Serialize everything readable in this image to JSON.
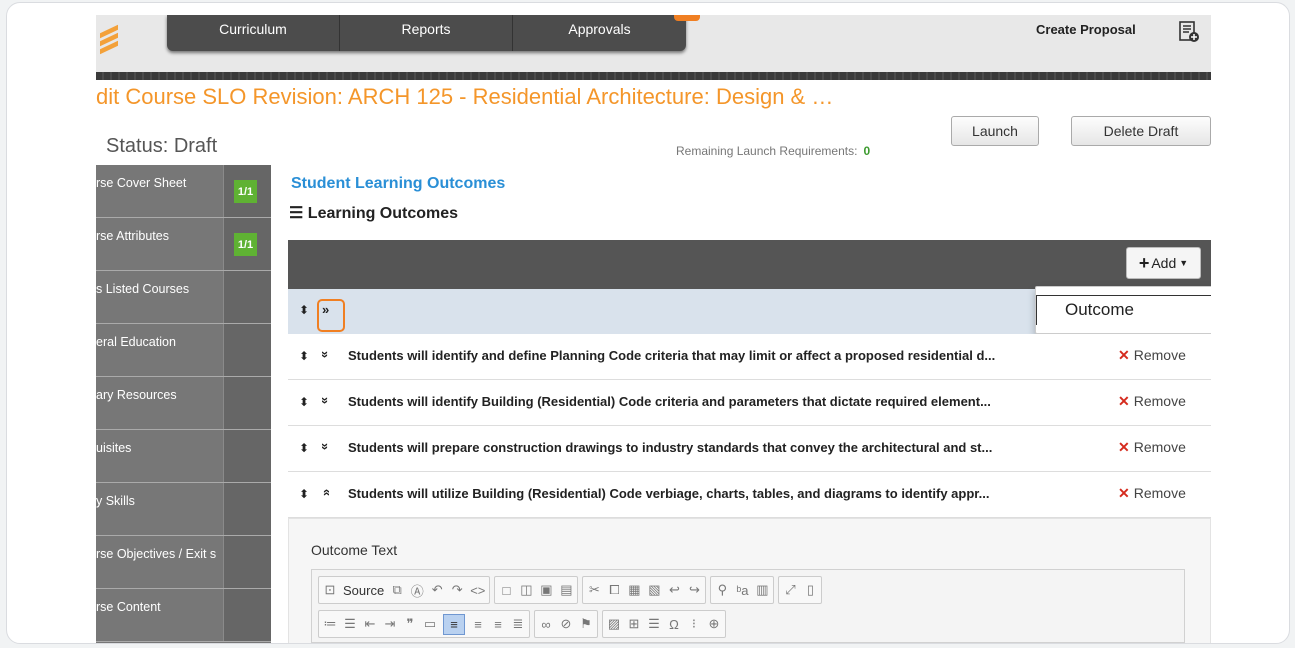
{
  "nav": {
    "items": [
      "Curriculum",
      "Reports",
      "Approvals"
    ],
    "create_label": "Create Proposal"
  },
  "header": {
    "title": "dit Course SLO Revision: ARCH 125 - Residential Architecture: Design & …",
    "status": "Status: Draft",
    "requirements_label": "Remaining Launch Requirements:",
    "requirements_count": "0",
    "launch_label": "Launch",
    "delete_label": "Delete Draft"
  },
  "sidebar": {
    "items": [
      {
        "label": "rse Cover Sheet",
        "count": "1/1"
      },
      {
        "label": "rse Attributes",
        "count": "1/1"
      },
      {
        "label": "s Listed Courses",
        "count": ""
      },
      {
        "label": "eral Education",
        "count": ""
      },
      {
        "label": "ary Resources",
        "count": ""
      },
      {
        "label": "uisites",
        "count": ""
      },
      {
        "label": "y Skills",
        "count": ""
      },
      {
        "label": "rse Objectives / Exit s",
        "count": ""
      },
      {
        "label": "rse Content",
        "count": ""
      }
    ]
  },
  "main": {
    "section_title": "Student Learning Outcomes",
    "outcomes_title": "Learning Outcomes",
    "add_label": "Add",
    "dropdown_option": "Outcome",
    "remove_label": "Remove",
    "outcomes": [
      "Students will identify and define Planning Code criteria that may limit or affect a proposed residential d...",
      "Students will identify Building (Residential) Code criteria and parameters that dictate required element...",
      "Students will prepare construction drawings to industry standards that convey the architectural and st...",
      "Students will utilize Building (Residential) Code verbiage, charts, tables, and diagrams to identify appr..."
    ],
    "outcome_text_label": "Outcome Text",
    "source_label": "Source"
  },
  "colors": {
    "accent_orange": "#f4962a",
    "link_blue": "#2a8fd6",
    "remove_red": "#d52b1e",
    "chip_green": "#5fb233"
  }
}
